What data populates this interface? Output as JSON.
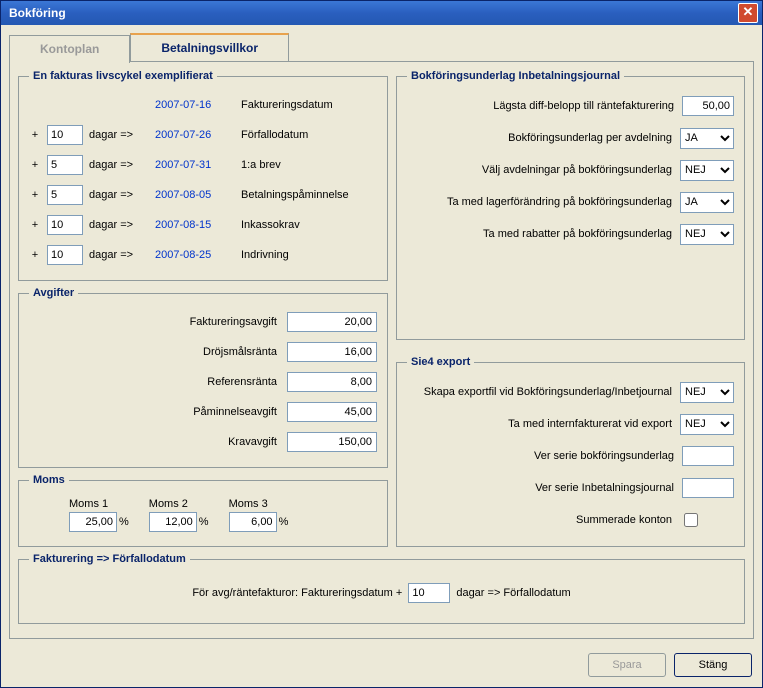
{
  "window": {
    "title": "Bokföring"
  },
  "tabs": {
    "kontoplan": "Kontoplan",
    "betalningsvillkor": "Betalningsvillkor"
  },
  "lifecycle": {
    "legend": "En fakturas livscykel exemplifierat",
    "plus": "+",
    "dagar": "dagar =>",
    "rows": [
      {
        "days": "",
        "date": "2007-07-16",
        "stage": "Faktureringsdatum"
      },
      {
        "days": "10",
        "date": "2007-07-26",
        "stage": "Förfallodatum"
      },
      {
        "days": "5",
        "date": "2007-07-31",
        "stage": "1:a brev"
      },
      {
        "days": "5",
        "date": "2007-08-05",
        "stage": "Betalningspåminnelse"
      },
      {
        "days": "10",
        "date": "2007-08-15",
        "stage": "Inkassokrav"
      },
      {
        "days": "10",
        "date": "2007-08-25",
        "stage": "Indrivning"
      }
    ]
  },
  "fees": {
    "legend": "Avgifter",
    "rows": [
      {
        "label": "Faktureringsavgift",
        "value": "20,00"
      },
      {
        "label": "Dröjsmålsränta",
        "value": "16,00"
      },
      {
        "label": "Referensränta",
        "value": "8,00"
      },
      {
        "label": "Påminnelseavgift",
        "value": "45,00"
      },
      {
        "label": "Kravavgift",
        "value": "150,00"
      }
    ]
  },
  "moms": {
    "legend": "Moms",
    "pct": "%",
    "items": [
      {
        "label": "Moms 1",
        "value": "25,00"
      },
      {
        "label": "Moms 2",
        "value": "12,00"
      },
      {
        "label": "Moms 3",
        "value": "6,00"
      }
    ]
  },
  "bokf": {
    "legend": "Bokföringsunderlag Inbetalningsjournal",
    "rows": {
      "diff": {
        "label": "Lägsta diff-belopp till räntefakturering",
        "value": "50,00"
      },
      "avd": {
        "label": "Bokföringsunderlag per avdelning",
        "value": "JA"
      },
      "valjavd": {
        "label": "Välj avdelningar på bokföringsunderlag",
        "value": "NEJ"
      },
      "lager": {
        "label": "Ta med lagerförändring på bokföringsunderlag",
        "value": "JA"
      },
      "rabatt": {
        "label": "Ta med rabatter på bokföringsunderlag",
        "value": "NEJ"
      }
    }
  },
  "sie": {
    "legend": "Sie4 export",
    "rows": {
      "skapa": {
        "label": "Skapa exportfil vid Bokföringsunderlag/Inbetjournal",
        "value": "NEJ"
      },
      "intern": {
        "label": "Ta med internfakturerat vid export",
        "value": "NEJ"
      },
      "serbok": {
        "label": "Ver serie bokföringsunderlag",
        "value": ""
      },
      "serinbet": {
        "label": "Ver serie Inbetalningsjournal",
        "value": ""
      },
      "sum": {
        "label": "Summerade konton"
      }
    }
  },
  "fakt": {
    "legend": "Fakturering => Förfallodatum",
    "pre": "För avg/räntefakturor: Faktureringsdatum +",
    "days": "10",
    "post": "dagar => Förfallodatum"
  },
  "options": {
    "ja": "JA",
    "nej": "NEJ"
  },
  "buttons": {
    "spara": "Spara",
    "stang": "Stäng"
  }
}
